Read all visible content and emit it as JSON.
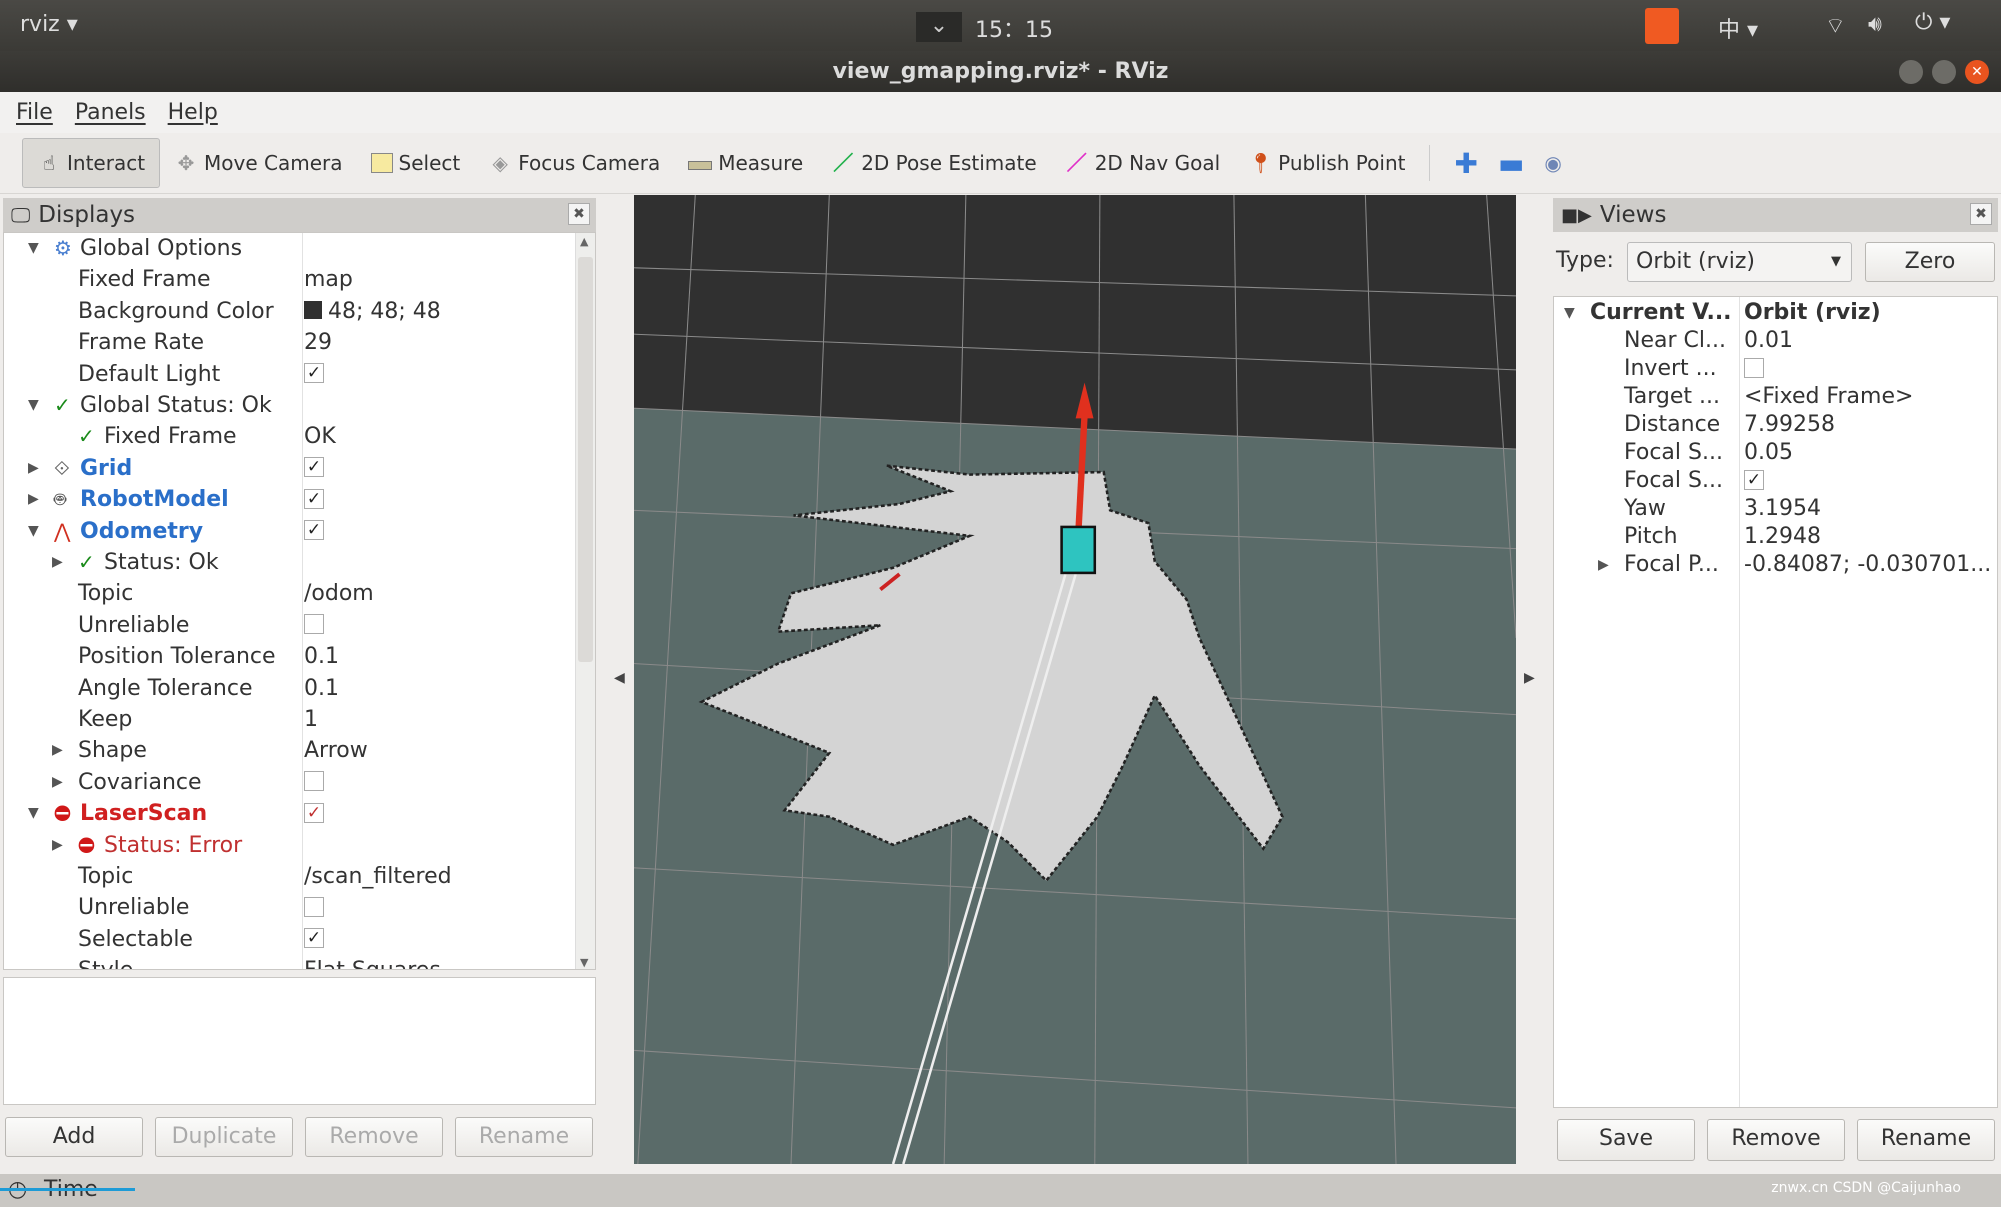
{
  "topbar": {
    "app_menu": "rviz ▾",
    "clock": "15：15",
    "input_method": "中 ▾"
  },
  "window": {
    "title": "view_gmapping.rviz* - RViz"
  },
  "menu": [
    "File",
    "Panels",
    "Help"
  ],
  "toolbar": {
    "tools": [
      {
        "label": "Interact",
        "icon": "hand-icon",
        "active": true
      },
      {
        "label": "Move Camera",
        "icon": "move-camera-icon"
      },
      {
        "label": "Select",
        "icon": "select-icon"
      },
      {
        "label": "Focus Camera",
        "icon": "focus-camera-icon"
      },
      {
        "label": "Measure",
        "icon": "ruler-icon"
      },
      {
        "label": "2D Pose Estimate",
        "icon": "green-arrow-icon"
      },
      {
        "label": "2D Nav Goal",
        "icon": "pink-arrow-icon"
      },
      {
        "label": "Publish Point",
        "icon": "map-pin-icon"
      }
    ]
  },
  "displays": {
    "title": "Displays",
    "rows": [
      {
        "label": "Global Options",
        "value": "",
        "level": 0,
        "exp": "open",
        "icon": "gear"
      },
      {
        "label": "Fixed Frame",
        "value": "map",
        "level": 1
      },
      {
        "label": "Background Color",
        "value": "48; 48; 48",
        "level": 1,
        "swatch": "#303030"
      },
      {
        "label": "Frame Rate",
        "value": "29",
        "level": 1
      },
      {
        "label": "Default Light",
        "check": true,
        "level": 1
      },
      {
        "label": "Global Status: Ok",
        "value": "",
        "level": 0,
        "exp": "open",
        "icon": "ok"
      },
      {
        "label": "Fixed Frame",
        "value": "OK",
        "level": 1,
        "icon": "ok"
      },
      {
        "label": "Grid",
        "check": true,
        "level": 0,
        "exp": "closed",
        "icon": "grid",
        "style": "blue"
      },
      {
        "label": "RobotModel",
        "check": true,
        "level": 0,
        "exp": "closed",
        "icon": "robot",
        "style": "blue"
      },
      {
        "label": "Odometry",
        "check": true,
        "level": 0,
        "exp": "open",
        "icon": "odom",
        "style": "blue"
      },
      {
        "label": "Status: Ok",
        "value": "",
        "level": 1,
        "exp": "closed",
        "icon": "ok"
      },
      {
        "label": "Topic",
        "value": "/odom",
        "level": 1
      },
      {
        "label": "Unreliable",
        "check": false,
        "level": 1
      },
      {
        "label": "Position Tolerance",
        "value": "0.1",
        "level": 1
      },
      {
        "label": "Angle Tolerance",
        "value": "0.1",
        "level": 1
      },
      {
        "label": "Keep",
        "value": "1",
        "level": 1
      },
      {
        "label": "Shape",
        "value": "Arrow",
        "level": 1,
        "exp": "closed"
      },
      {
        "label": "Covariance",
        "check": false,
        "level": 1,
        "exp": "closed"
      },
      {
        "label": "LaserScan",
        "check": true,
        "level": 0,
        "exp": "open",
        "icon": "error",
        "style": "red"
      },
      {
        "label": "Status: Error",
        "value": "",
        "level": 1,
        "exp": "closed",
        "icon": "error",
        "style": "redlight"
      },
      {
        "label": "Topic",
        "value": "/scan_filtered",
        "level": 1
      },
      {
        "label": "Unreliable",
        "check": false,
        "level": 1
      },
      {
        "label": "Selectable",
        "check": true,
        "level": 1
      },
      {
        "label": "Style",
        "value": "Flat Squares",
        "level": 1
      }
    ],
    "buttons": {
      "add": "Add",
      "duplicate": "Duplicate",
      "remove": "Remove",
      "rename": "Rename"
    }
  },
  "views": {
    "title": "Views",
    "type_label": "Type:",
    "type_value": "Orbit (rviz)",
    "zero": "Zero",
    "rows": [
      {
        "label": "Current V...",
        "value": "Orbit (rviz)",
        "level": 0,
        "exp": "open",
        "bold": true
      },
      {
        "label": "Near Cl...",
        "value": "0.01",
        "level": 1
      },
      {
        "label": "Invert ...",
        "check": false,
        "level": 1
      },
      {
        "label": "Target ...",
        "value": "<Fixed Frame>",
        "level": 1
      },
      {
        "label": "Distance",
        "value": "7.99258",
        "level": 1
      },
      {
        "label": "Focal S...",
        "value": "0.05",
        "level": 1
      },
      {
        "label": "Focal S...",
        "check": true,
        "level": 1
      },
      {
        "label": "Yaw",
        "value": "3.1954",
        "level": 1
      },
      {
        "label": "Pitch",
        "value": "1.2948",
        "level": 1
      },
      {
        "label": "Focal P...",
        "value": "-0.84087; -0.030701...",
        "level": 1,
        "exp": "closed"
      }
    ],
    "buttons": {
      "save": "Save",
      "remove": "Remove",
      "rename": "Rename"
    }
  },
  "timebar": {
    "label": "Time"
  },
  "watermark": "znwx.cn CSDN @Caijunhao",
  "colors": {
    "background": "#303030",
    "floor": "#5a6b69",
    "map_free": "#d4d4d4",
    "arrow": "#e0301e",
    "robot": "#2ec4c0"
  }
}
